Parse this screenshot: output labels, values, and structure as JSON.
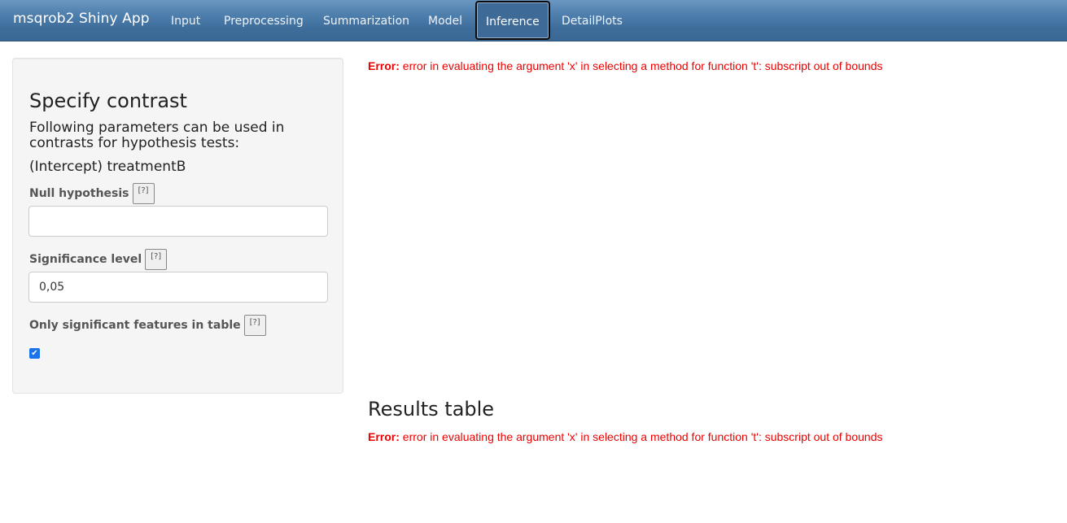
{
  "navbar": {
    "brand": "msqrob2 Shiny App",
    "tabs": [
      {
        "label": "Input",
        "active": false
      },
      {
        "label": "Preprocessing",
        "active": false
      },
      {
        "label": "Summarization",
        "active": false
      },
      {
        "label": "Model",
        "active": false
      },
      {
        "label": "Inference",
        "active": true
      },
      {
        "label": "DetailPlots",
        "active": false
      }
    ]
  },
  "sidebar": {
    "title": "Specify contrast",
    "description": "Following parameters can be used in contrasts for hypothesis tests:",
    "parameters": "(Intercept) treatmentB",
    "help_label": "[?]",
    "null_hypothesis": {
      "label": "Null hypothesis",
      "value": "",
      "placeholder": ""
    },
    "significance_level": {
      "label": "Significance level",
      "value": "0,05"
    },
    "only_significant": {
      "label": "Only significant features in table",
      "checked": true,
      "check_glyph": "✔"
    }
  },
  "main": {
    "error_prefix": "Error:",
    "error_message": "error in evaluating the argument 'x' in selecting a method for function 't': subscript out of bounds",
    "results_title": "Results table",
    "colors": {
      "error": "#ee0000",
      "navbar": "#3e6d9b"
    }
  }
}
